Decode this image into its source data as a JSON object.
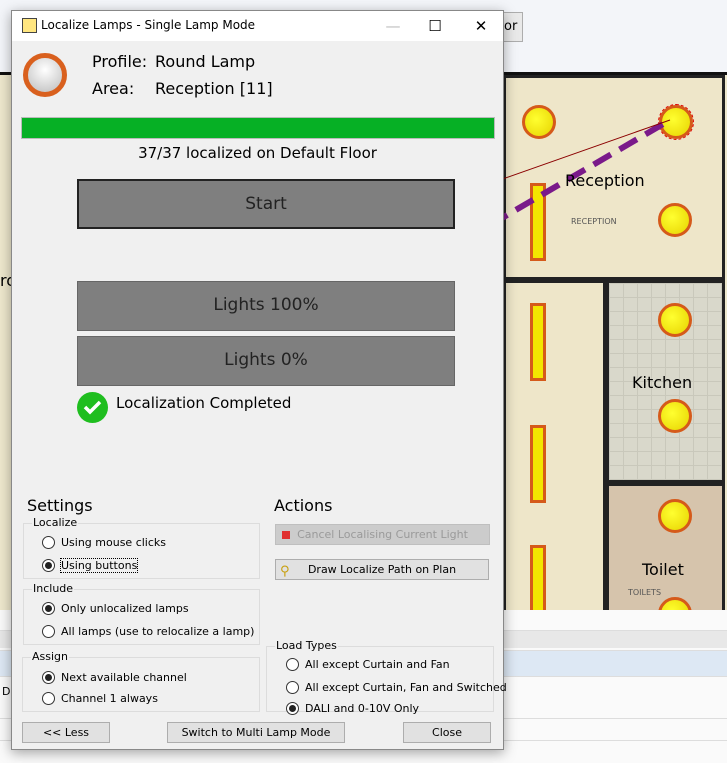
{
  "background": {
    "toolbar_button_partial": "or",
    "rooms": [
      {
        "label": "Reception",
        "sublabel": "RECEPTION"
      },
      {
        "label": "Kitchen"
      },
      {
        "label": "Toilet",
        "sublabel": "TOILETS"
      }
    ],
    "left_partial_label": "ro",
    "bottom_partial_label": "De"
  },
  "dialog": {
    "title": "Localize Lamps - Single Lamp Mode",
    "controls": {
      "minimize": "—",
      "maximize": "☐",
      "close": "✕"
    },
    "profile_label": "Profile:",
    "profile_value": "Round Lamp",
    "area_label": "Area:",
    "area_value": "Reception [11]",
    "progress": {
      "localized": 37,
      "total": 37,
      "percent": 100,
      "text": "37/37 localized on Default Floor",
      "color": "#06b025"
    },
    "start_button": "Start",
    "lights_100_button": "Lights 100%",
    "lights_0_button": "Lights 0%",
    "status": "Localization Completed",
    "settings": {
      "heading": "Settings",
      "localize": {
        "title": "Localize",
        "options": [
          {
            "label": "Using mouse clicks",
            "selected": false
          },
          {
            "label": "Using buttons",
            "selected": true
          }
        ]
      },
      "include": {
        "title": "Include",
        "options": [
          {
            "label": "Only unlocalized lamps",
            "selected": true
          },
          {
            "label": "All lamps (use to relocalize a lamp)",
            "selected": false
          }
        ]
      },
      "assign": {
        "title": "Assign",
        "options": [
          {
            "label": "Next available channel",
            "selected": true
          },
          {
            "label": "Channel 1 always",
            "selected": false
          }
        ]
      }
    },
    "actions": {
      "heading": "Actions",
      "cancel_button": "Cancel Localising Current Light",
      "draw_path_button": "Draw Localize Path on Plan",
      "load_types": {
        "title": "Load Types",
        "options": [
          {
            "label": "All except Curtain and Fan",
            "selected": false
          },
          {
            "label": "All except Curtain, Fan and Switched",
            "selected": false
          },
          {
            "label": "DALI and 0-10V Only",
            "selected": true
          }
        ]
      }
    },
    "footer": {
      "less_button": "<< Less",
      "switch_button": "Switch to Multi Lamp Mode",
      "close_button": "Close"
    }
  }
}
